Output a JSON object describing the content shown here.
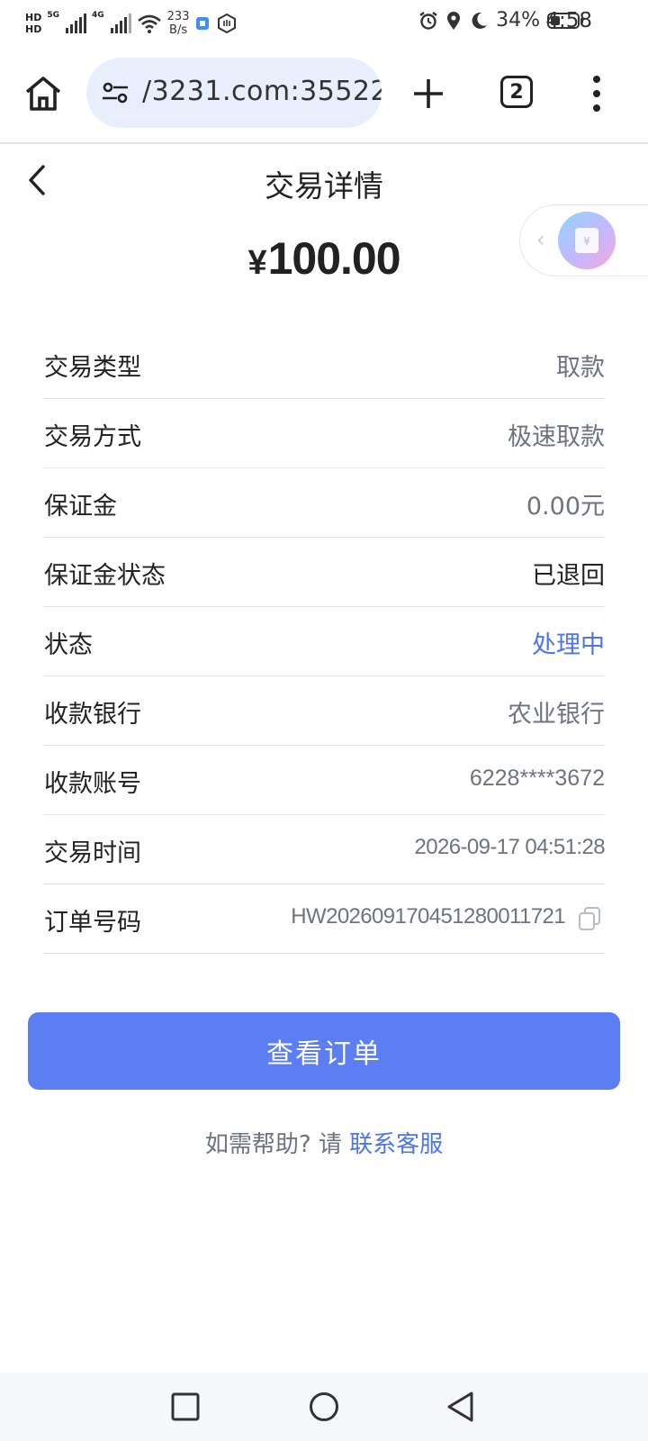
{
  "status_bar": {
    "hd_1": "HD",
    "hd_2": "HD",
    "net_1": "5G",
    "net_2": "4G",
    "speed_value": "233",
    "speed_unit": "B/s",
    "battery_percent": "34%",
    "battery_level": 0.34,
    "time": "4:58"
  },
  "browser": {
    "url": "/3231.com:35522",
    "tab_count": "2"
  },
  "header": {
    "title": "交易详情",
    "amount_currency": "¥",
    "amount_value": "100.00"
  },
  "details": [
    {
      "label": "交易类型",
      "value": "取款"
    },
    {
      "label": "交易方式",
      "value": "极速取款"
    },
    {
      "label": "保证金",
      "value": "0.00元"
    },
    {
      "label": "保证金状态",
      "value": "已退回"
    },
    {
      "label": "状态",
      "value": "处理中"
    },
    {
      "label": "收款银行",
      "value": "农业银行"
    },
    {
      "label": "收款账号",
      "value": "6228****3672"
    },
    {
      "label": "交易时间",
      "value": "2026-09-17 04:51:28"
    },
    {
      "label": "订单号码",
      "value": "HW20260917045128001172​1"
    }
  ],
  "actions": {
    "view_order_label": "查看订单"
  },
  "help": {
    "prefix": "如需帮助? 请 ",
    "link": "联系客服"
  },
  "colors": {
    "accent": "#5b7ff2",
    "link": "#4d74ea",
    "value_gray": "#6e7380"
  },
  "icons": {
    "floating_widget": "wallet-icon"
  }
}
